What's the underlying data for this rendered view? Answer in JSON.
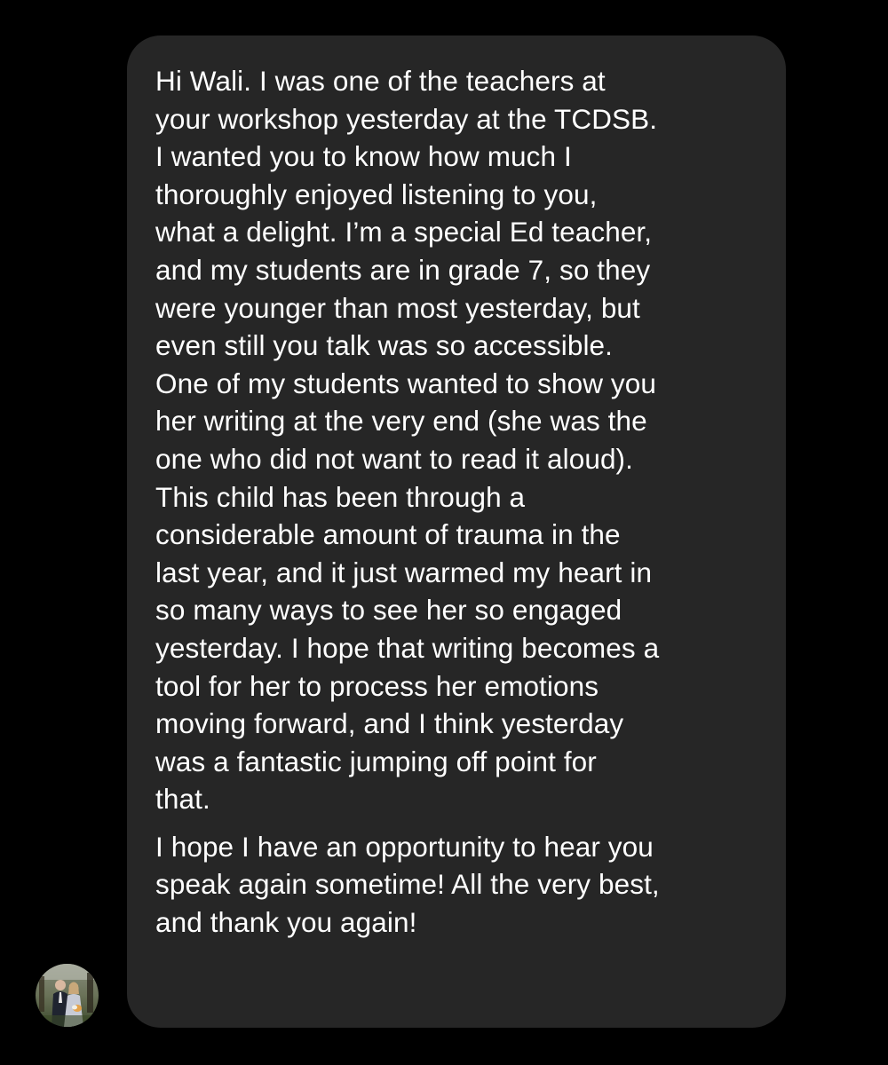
{
  "conversation": {
    "message": {
      "paragraphs": [
        {
          "lines": [
            "Hi Wali. I was one of the teachers at",
            "your workshop yesterday at the TCDSB.",
            "I wanted you to know how much I",
            "thoroughly enjoyed listening to you,",
            "what a delight. I’m a special Ed teacher,",
            "and my students are in grade 7, so they",
            "were younger than most yesterday, but",
            "even still you talk was so accessible.",
            "One of my students wanted to show you",
            "her writing at the very end (she was the",
            "one who did not want to read it aloud).",
            "This child has been through a",
            "considerable amount of trauma in the",
            "last year, and it just warmed my heart in",
            "so many ways to see her so engaged",
            "yesterday. I hope that writing becomes a",
            "tool for her to process her emotions",
            "moving forward, and I think yesterday",
            "was a fantastic jumping off point for",
            "that."
          ]
        },
        {
          "lines": [
            "I hope I have an opportunity to hear you",
            "speak again sometime! All the very best,",
            "and thank you again!"
          ]
        }
      ]
    },
    "sender": {
      "avatar_icon": "profile-photo-icon"
    }
  },
  "colors": {
    "background": "#000000",
    "bubble": "#262626",
    "text": "#ffffff"
  }
}
